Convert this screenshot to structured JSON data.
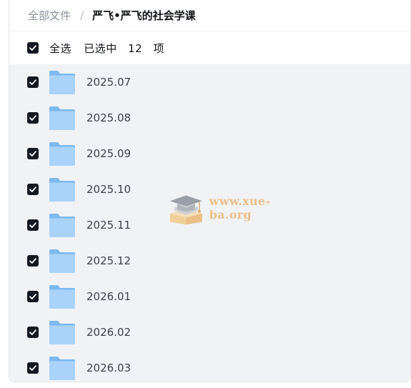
{
  "breadcrumb": {
    "root": "全部文件",
    "separator": "/",
    "current": "严飞•严飞的社会学课"
  },
  "selection": {
    "select_all_label": "全选",
    "selected_prefix": "已选中",
    "selected_count": "12",
    "selected_suffix": "项",
    "all_checked": true
  },
  "folders": [
    {
      "name": "2025.07",
      "checked": true
    },
    {
      "name": "2025.08",
      "checked": true
    },
    {
      "name": "2025.09",
      "checked": true
    },
    {
      "name": "2025.10",
      "checked": true
    },
    {
      "name": "2025.11",
      "checked": true
    },
    {
      "name": "2025.12",
      "checked": true
    },
    {
      "name": "2026.01",
      "checked": true
    },
    {
      "name": "2026.02",
      "checked": true
    },
    {
      "name": "2026.03",
      "checked": true
    }
  ],
  "icons": {
    "checkbox": "checkbox-checked-icon",
    "folder": "folder-icon",
    "watermark": "graduation-cap-book-logo"
  },
  "watermark": {
    "text": "www.xue-ba.org"
  },
  "colors": {
    "checkbox": "#141821",
    "folder_back": "#7db9f0",
    "folder_front": "#a9d3fa",
    "list_background": "#f1f2f5",
    "watermark_text": "#e8b876"
  }
}
